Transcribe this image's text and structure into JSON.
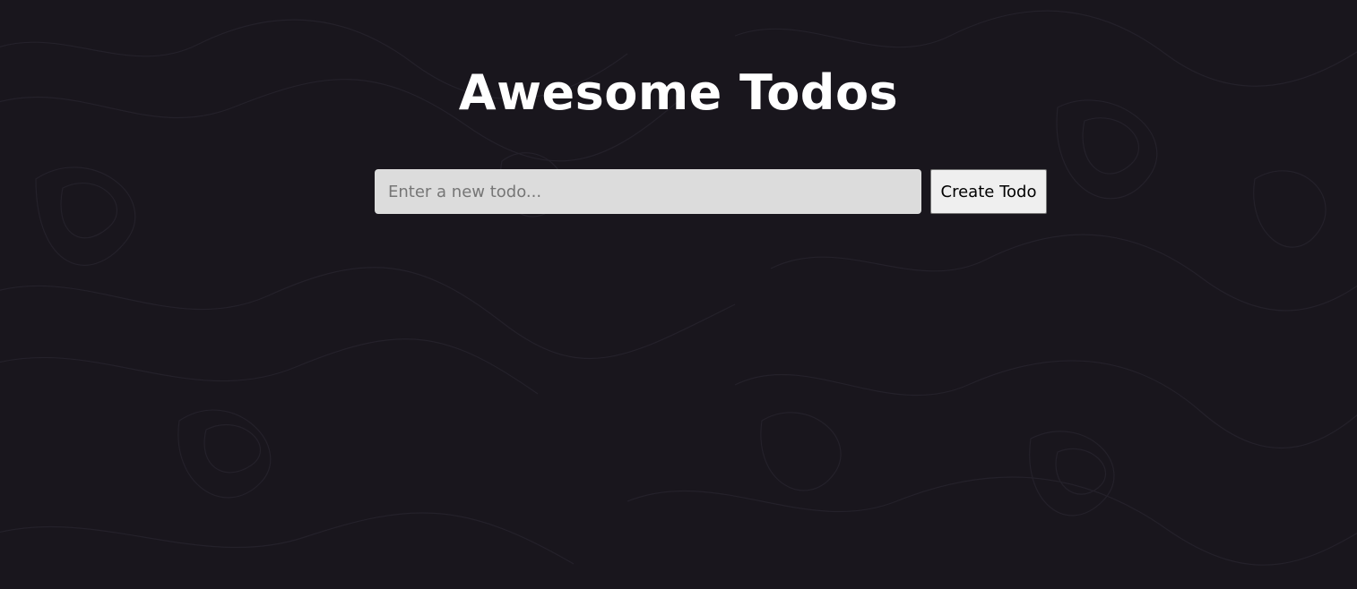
{
  "header": {
    "title": "Awesome Todos"
  },
  "form": {
    "input_value": "",
    "input_placeholder": "Enter a new todo...",
    "submit_label": "Create Todo"
  },
  "colors": {
    "background": "#19161d",
    "title_text": "#ffffff",
    "input_background": "#dcdcdc",
    "button_background": "#efefef"
  }
}
